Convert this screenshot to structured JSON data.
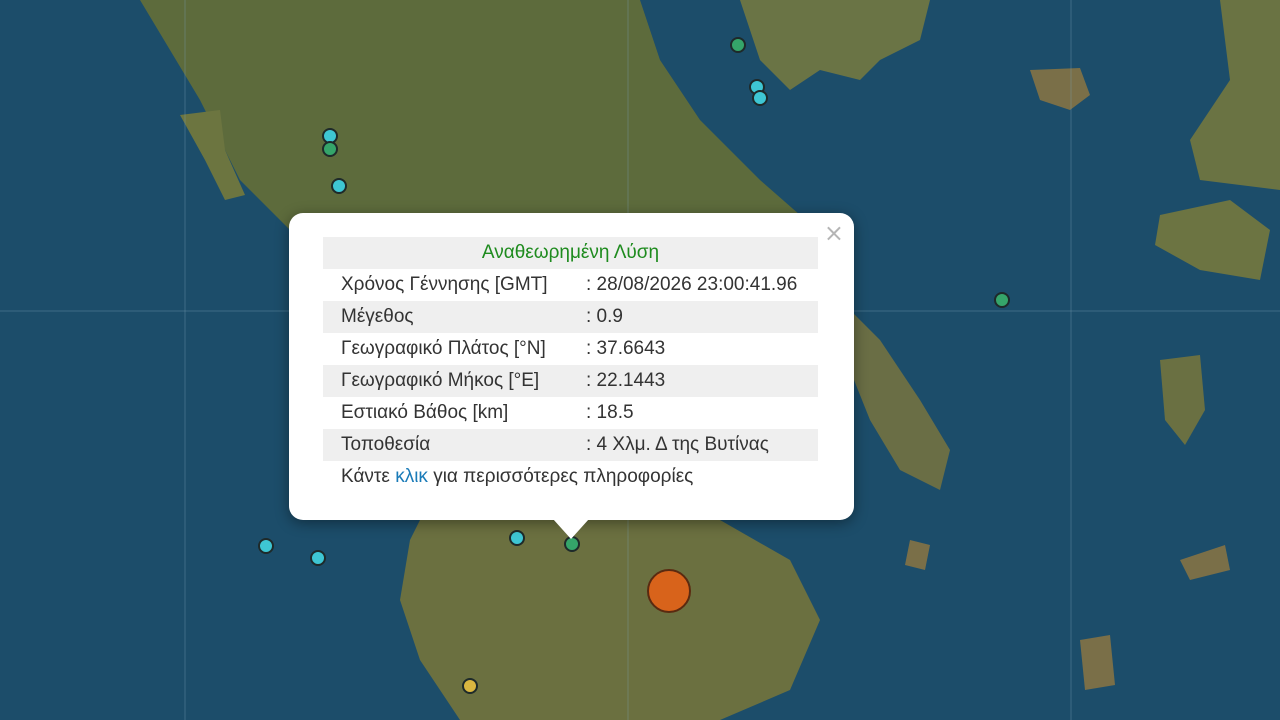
{
  "map": {
    "markers": [
      {
        "color": "green",
        "magnitude_class": "small"
      },
      {
        "color": "cyan",
        "magnitude_class": "small"
      },
      {
        "color": "cyan",
        "magnitude_class": "small"
      },
      {
        "color": "cyan",
        "magnitude_class": "small"
      },
      {
        "color": "green",
        "magnitude_class": "small"
      },
      {
        "color": "cyan",
        "magnitude_class": "small"
      },
      {
        "color": "green",
        "magnitude_class": "small"
      },
      {
        "color": "cyan",
        "magnitude_class": "small"
      },
      {
        "color": "cyan",
        "magnitude_class": "small"
      },
      {
        "color": "cyan",
        "magnitude_class": "small"
      },
      {
        "color": "green",
        "magnitude_class": "selected"
      },
      {
        "color": "orange",
        "magnitude_class": "large"
      },
      {
        "color": "yellow",
        "magnitude_class": "small"
      }
    ],
    "colors": {
      "sea": "#1c4d6a",
      "cyan": "#3ec6d3",
      "green": "#35a56a",
      "orange": "#d8631b",
      "yellow": "#d9b640"
    }
  },
  "popup": {
    "title": "Αναθεωρημένη Λύση",
    "rows": [
      {
        "label": "Χρόνος Γέννησης [GMT]",
        "value": ": 28/08/2026 23:00:41.96"
      },
      {
        "label": "Μέγεθος",
        "value": ": 0.9"
      },
      {
        "label": "Γεωγραφικό Πλάτος [°N]",
        "value": ": 37.6643"
      },
      {
        "label": "Γεωγραφικό Μήκος [°E]",
        "value": ": 22.1443"
      },
      {
        "label": "Εστιακό Βάθος [km]",
        "value": ": 18.5"
      },
      {
        "label": "Τοποθεσία",
        "value": ": 4 Χλμ. Δ της Βυτίνας"
      }
    ],
    "footer_prefix": "Κάντε ",
    "footer_link": "κλικ",
    "footer_suffix": " για περισσότερες πληροφορίες",
    "close_symbol": "×"
  }
}
